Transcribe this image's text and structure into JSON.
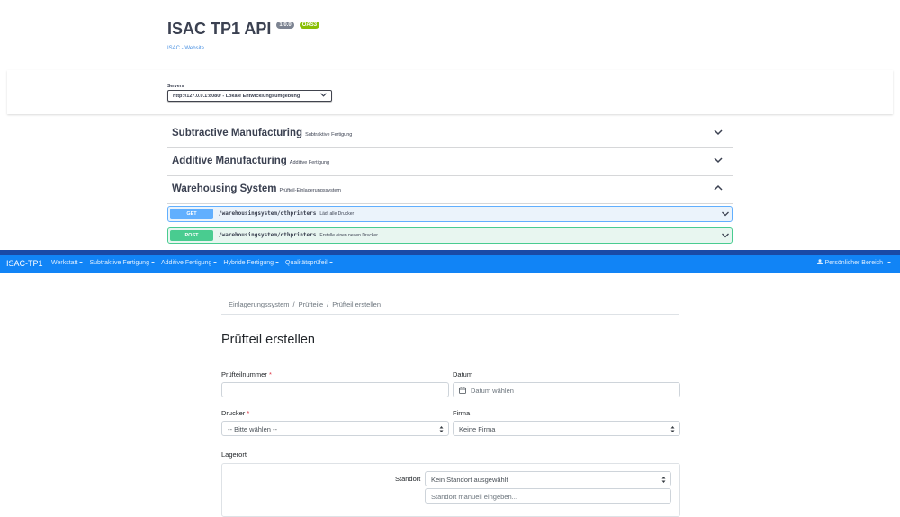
{
  "swagger": {
    "title": "ISAC TP1 API",
    "version": "1.0.0",
    "oas": "OAS3",
    "link": "ISAC - Website",
    "servers_label": "Servers",
    "server_selected": "http://127.0.0.1:8080/ - Lokale Entwicklungsumgebung",
    "tags": [
      {
        "name": "Subtractive Manufacturing",
        "desc": "Subtraktive Fertigung",
        "expanded": false
      },
      {
        "name": "Additive Manufacturing",
        "desc": "Additive Fertigung",
        "expanded": false
      },
      {
        "name": "Warehousing System",
        "desc": "Prüfteil-Einlagerungssystem",
        "expanded": true
      }
    ],
    "operations": [
      {
        "method": "GET",
        "path": "/warehousingsystem/othprinters",
        "summary": "Lädt alle Drucker",
        "color": "#61affe"
      },
      {
        "method": "POST",
        "path": "/warehousingsystem/othprinters",
        "summary": "Erstelle einen neuen Drucker",
        "color": "#49cc90"
      }
    ]
  },
  "app": {
    "brand": "ISAC-TP1",
    "nav": [
      "Werkstatt",
      "Subtraktive Fertigung",
      "Additive Fertigung",
      "Hybride Fertigung",
      "Qualitätsprüfeil"
    ],
    "user_menu": "Persönlicher Bereich",
    "accent": "#1184f6"
  },
  "breadcrumb": [
    "Einlagerungssystem",
    "Prüfteile",
    "Prüfteil erstellen"
  ],
  "form": {
    "title": "Prüfteil erstellen",
    "pruefteilnummer_label": "Prüfteilnummer",
    "pruefteilnummer_value": "",
    "datum_label": "Datum",
    "datum_placeholder": "Datum wählen",
    "drucker_label": "Drucker",
    "drucker_value": "-- Bitte wählen --",
    "firma_label": "Firma",
    "firma_value": "Keine Firma",
    "lagerort_label": "Lagerort",
    "standort_label": "Standort",
    "standort_value": "Kein Standort ausgewählt",
    "standort_manual_placeholder": "Standort manuell eingeben..."
  }
}
